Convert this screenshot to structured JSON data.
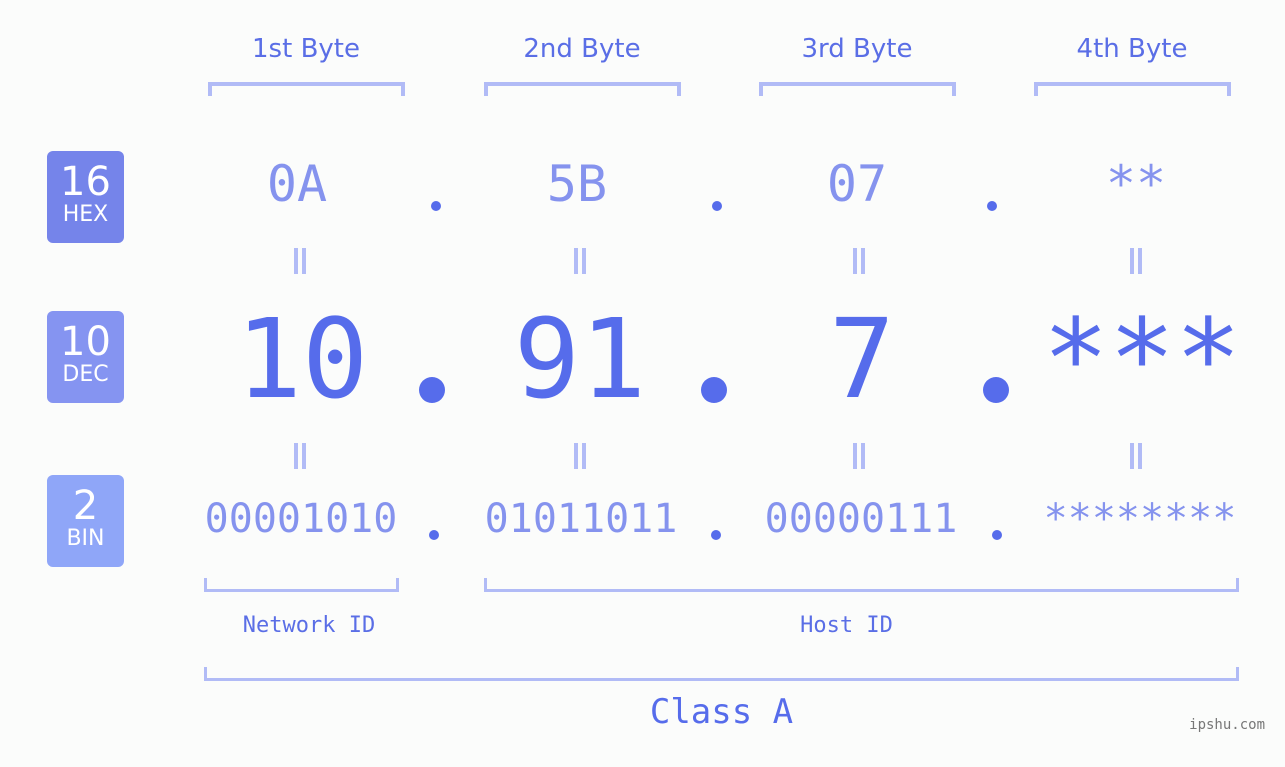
{
  "byte_headers": [
    "1st Byte",
    "2nd Byte",
    "3rd Byte",
    "4th Byte"
  ],
  "badges": {
    "hex": {
      "number": "16",
      "label": "HEX",
      "color": "#7584ea"
    },
    "dec": {
      "number": "10",
      "label": "DEC",
      "color": "#8594f1"
    },
    "bin": {
      "number": "2",
      "label": "BIN",
      "color": "#8fa6f8"
    }
  },
  "hex_values": [
    "0A",
    "5B",
    "07",
    "**"
  ],
  "dec_values": [
    "10",
    "91",
    "7",
    "***"
  ],
  "bin_values": [
    "00001010",
    "01011011",
    "00000111",
    "********"
  ],
  "separator": ".",
  "network_id_label": "Network ID",
  "host_id_label": "Host ID",
  "class_label": "Class A",
  "footer": "ipshu.com",
  "colors": {
    "accent": "#566ceb",
    "light": "#8593ee",
    "bracket": "#b1bbf6",
    "background": "#fbfcfb"
  }
}
